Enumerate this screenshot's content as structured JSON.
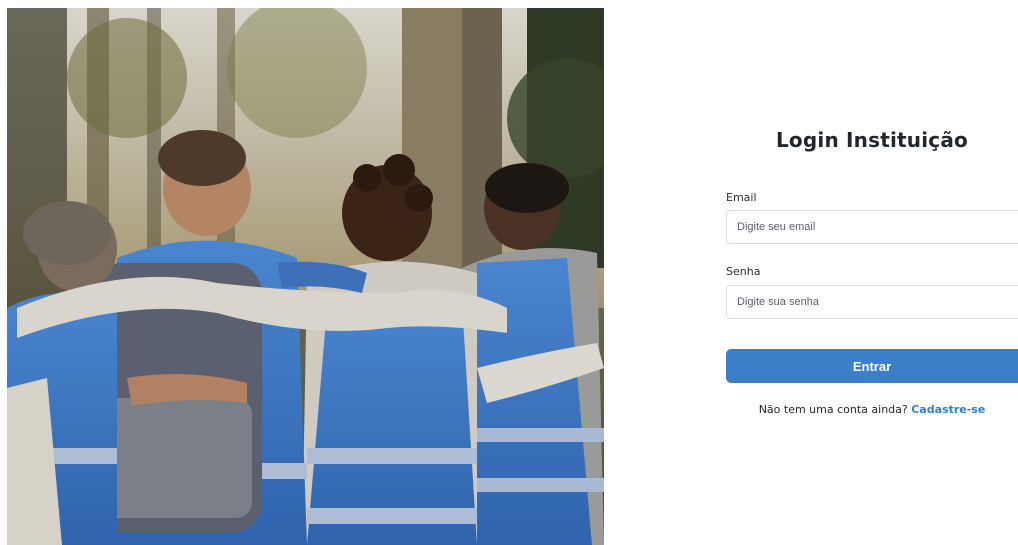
{
  "login": {
    "title": "Login Instituição",
    "email_label": "Email",
    "email_placeholder": "Digite seu email",
    "password_label": "Senha",
    "password_placeholder": "Digite sua senha",
    "submit_label": "Entrar",
    "signup_prompt": "Não tem uma conta ainda?",
    "signup_link": "Cadastre-se"
  },
  "colors": {
    "primary_button": "#3a7fc8",
    "link": "#2f7fd3",
    "vest": "#3a74c4"
  }
}
